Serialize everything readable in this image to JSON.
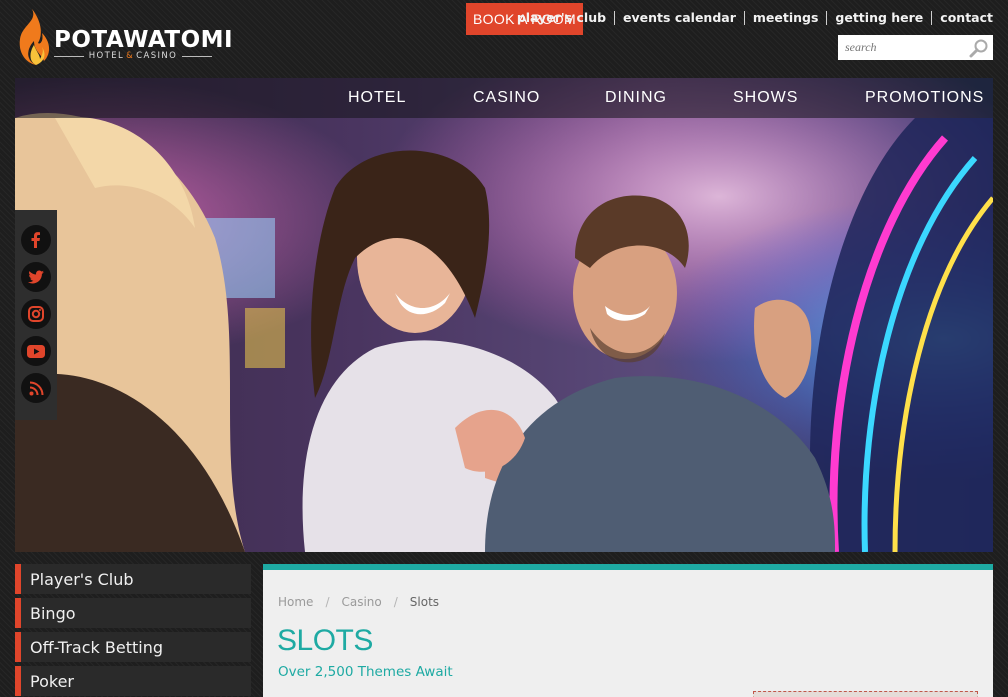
{
  "brand": {
    "name": "POTAWATOMI",
    "tagline_left": "HOTEL",
    "tagline_amp": "&",
    "tagline_right": "CASINO"
  },
  "header": {
    "book_button": "BOOK A ROOM",
    "links": [
      "player's club",
      "events calendar",
      "meetings",
      "getting here",
      "contact"
    ],
    "search_placeholder": "search"
  },
  "nav": [
    "HOTEL",
    "CASINO",
    "DINING",
    "SHOWS",
    "PROMOTIONS"
  ],
  "social": [
    "facebook-icon",
    "twitter-icon",
    "instagram-icon",
    "youtube-icon",
    "rss-icon"
  ],
  "sidebar": {
    "items": [
      "Player's Club",
      "Bingo",
      "Off-Track Betting",
      "Poker"
    ]
  },
  "breadcrumb": [
    "Home",
    "Casino",
    "Slots"
  ],
  "breadcrumb_sep": "/",
  "page": {
    "title": "SLOTS",
    "subtitle": "Over 2,500 Themes Await"
  },
  "colors": {
    "accent": "#e0452b",
    "teal": "#1eaaa3"
  }
}
